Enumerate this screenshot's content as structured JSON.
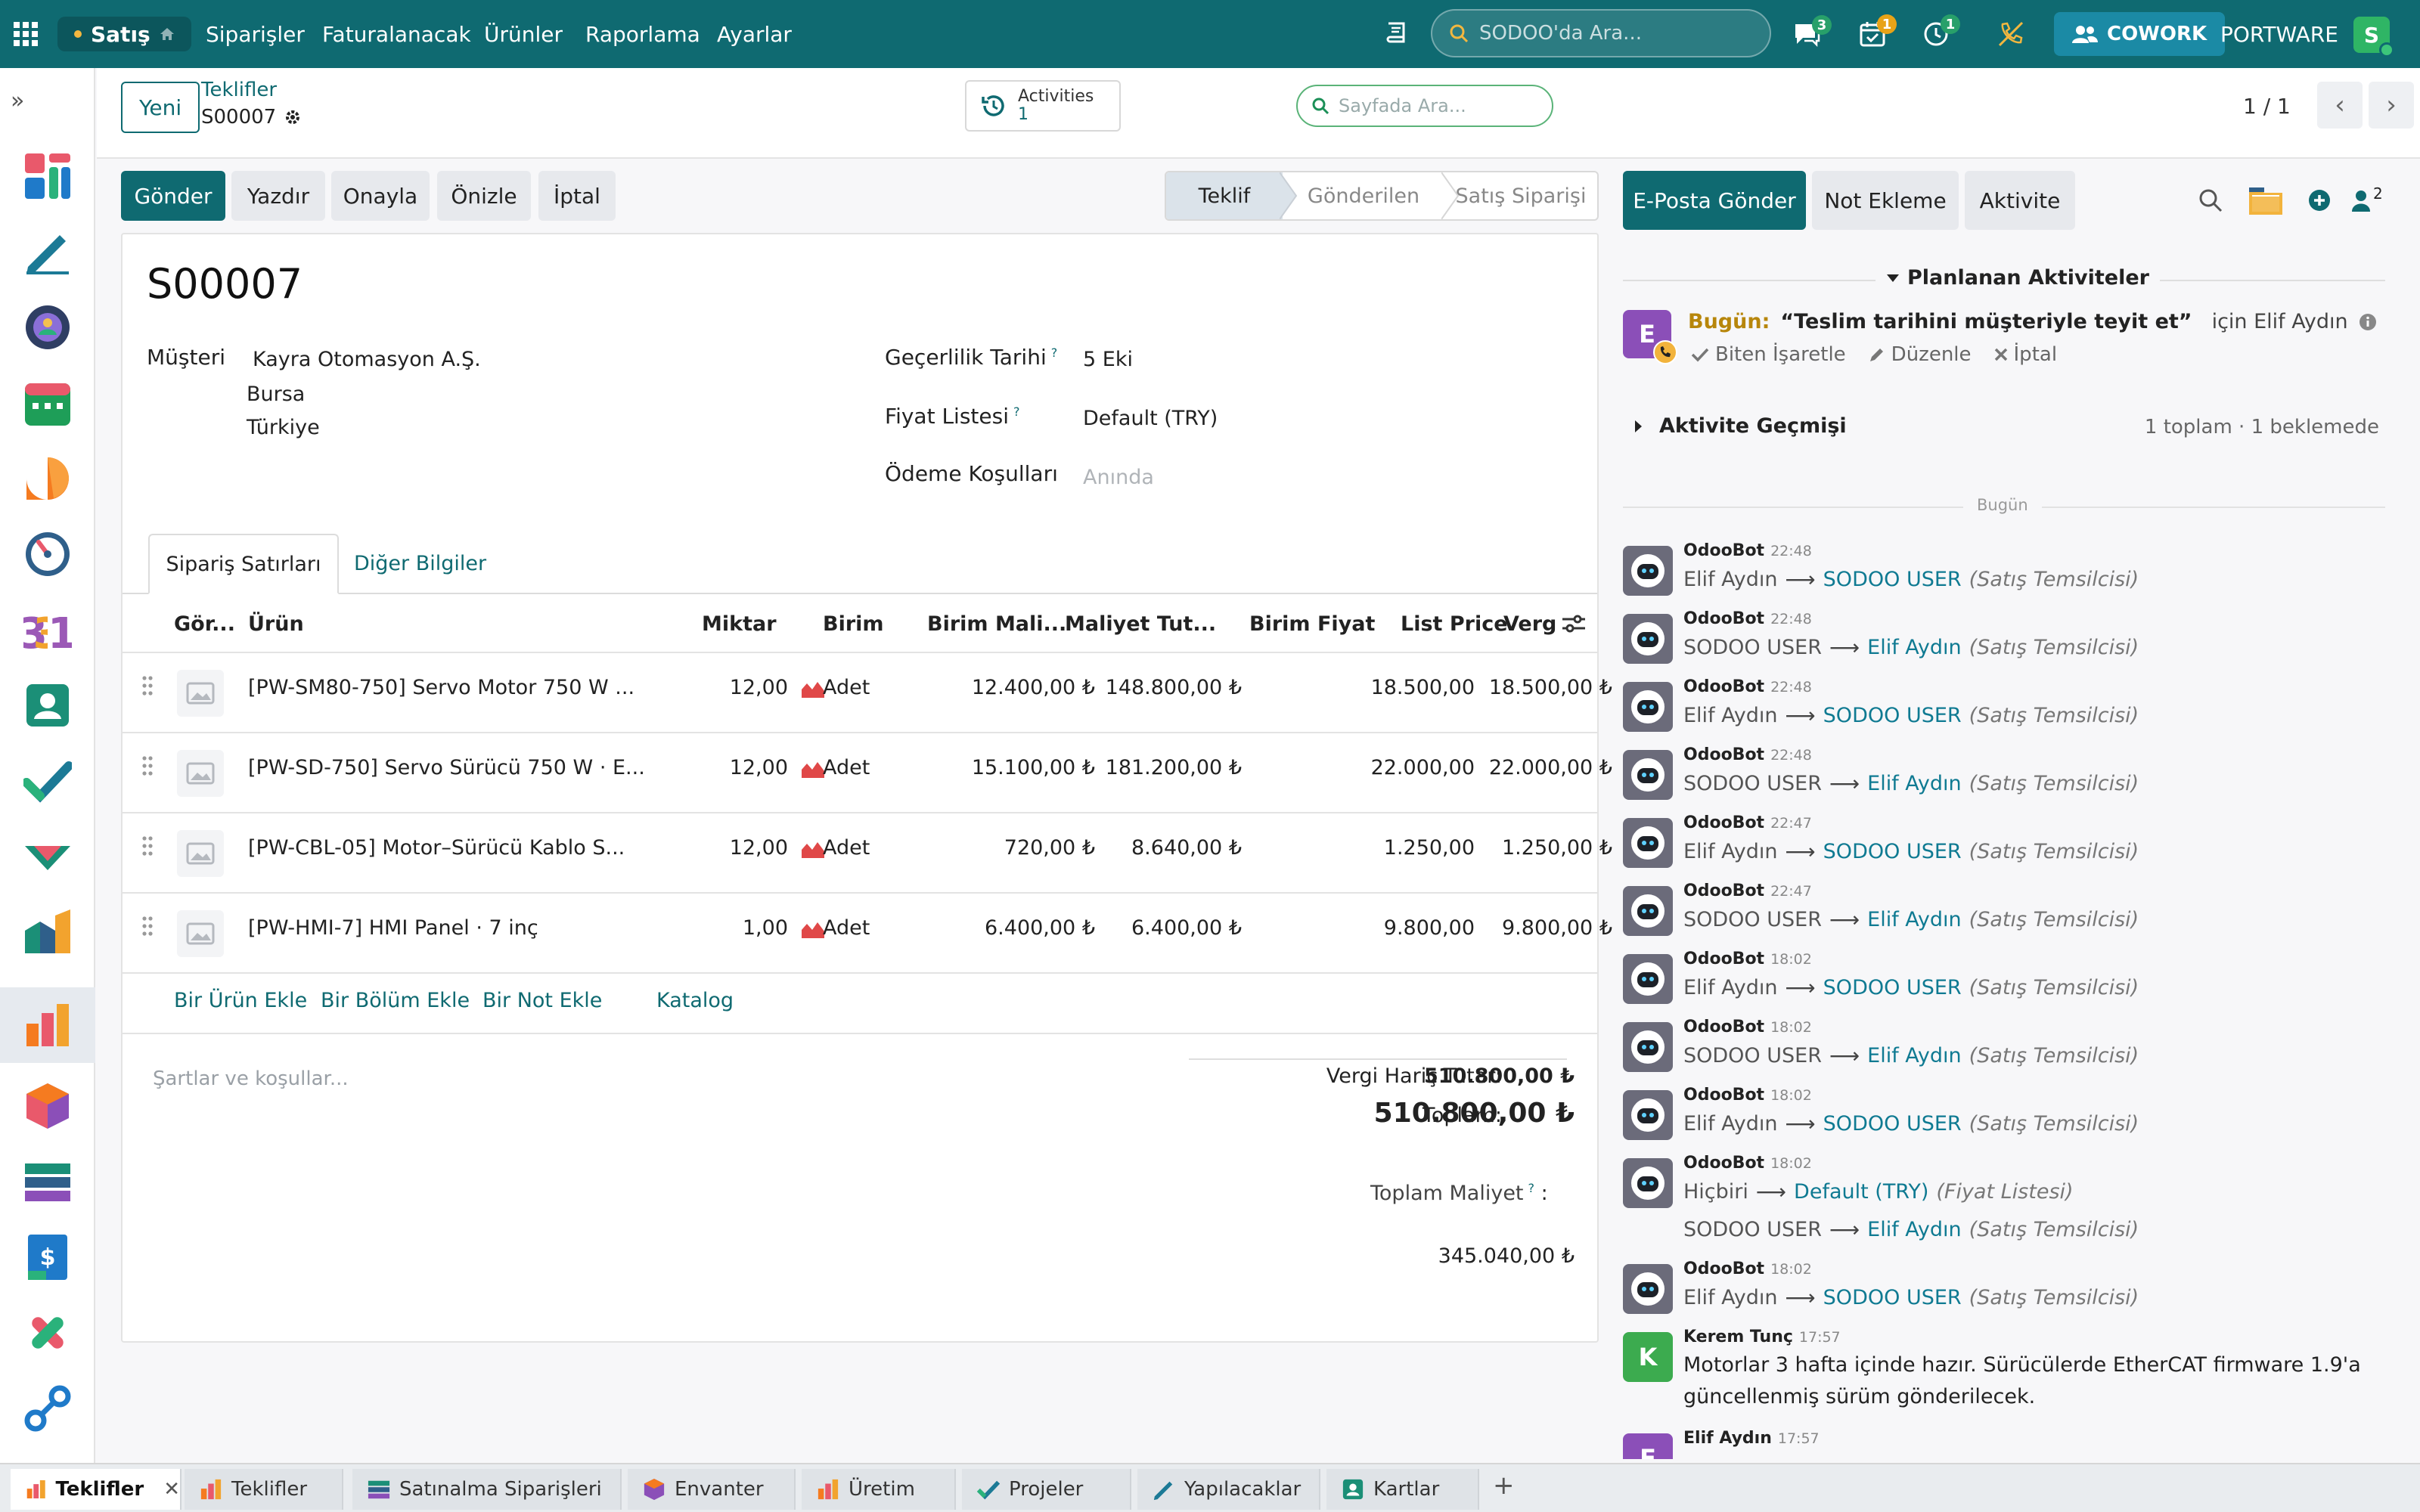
{
  "topbar": {
    "app_name": "Satış",
    "menu": [
      "Siparişler",
      "Faturalanacak",
      "Ürünler",
      "Raporlama",
      "Ayarlar"
    ],
    "search_placeholder": "SODOO'da Ara...",
    "badges": {
      "messages": "3",
      "activities": "1",
      "timer": "1"
    },
    "cowork": "COWORK",
    "company": "PORTWARE",
    "user_initial": "S"
  },
  "control": {
    "new_button": "Yeni",
    "breadcrumb_parent": "Teklifler",
    "breadcrumb_current": "S00007",
    "activities_label": "Activities",
    "activities_count": "1",
    "page_search_placeholder": "Sayfada Ara...",
    "pager": "1 / 1"
  },
  "actions": {
    "send": "Gönder",
    "print": "Yazdır",
    "confirm": "Onayla",
    "preview": "Önizle",
    "cancel": "İptal"
  },
  "status": [
    "Teklif",
    "Gönderilen",
    "Satış Siparişi"
  ],
  "form": {
    "title": "S00007",
    "customer_label": "Müşteri",
    "customer_name": "Kayra Otomasyon A.Ş.",
    "customer_city": "Bursa",
    "customer_country": "Türkiye",
    "validity_label": "Geçerlilik Tarihi",
    "validity_value": "5 Eki",
    "pricelist_label": "Fiyat Listesi",
    "pricelist_value": "Default (TRY)",
    "payment_label": "Ödeme Koşulları",
    "payment_placeholder": "Anında",
    "help_mark": "?",
    "tabs": [
      "Sipariş Satırları",
      "Diğer Bilgiler"
    ],
    "columns": [
      "Gör...",
      "Ürün",
      "Miktar",
      "Birim",
      "Birim Mali...",
      "Maliyet Tut...",
      "Birim Fiyat",
      "List Price",
      "Verg"
    ],
    "lines": [
      {
        "product": "[PW-SM80-750] Servo Motor 750 W ...",
        "qty": "12,00",
        "uom": "Adet",
        "unit_cost": "12.400,00 ₺",
        "cost_total": "148.800,00 ₺",
        "unit_price": "18.500,00",
        "list_price": "18.500,00 ₺"
      },
      {
        "product": "[PW-SD-750] Servo Sürücü 750 W · E...",
        "qty": "12,00",
        "uom": "Adet",
        "unit_cost": "15.100,00 ₺",
        "cost_total": "181.200,00 ₺",
        "unit_price": "22.000,00",
        "list_price": "22.000,00 ₺"
      },
      {
        "product": "[PW-CBL-05] Motor–Sürücü Kablo S...",
        "qty": "12,00",
        "uom": "Adet",
        "unit_cost": "720,00 ₺",
        "cost_total": "8.640,00 ₺",
        "unit_price": "1.250,00",
        "list_price": "1.250,00 ₺"
      },
      {
        "product": "[PW-HMI-7] HMI Panel · 7 inç",
        "qty": "1,00",
        "uom": "Adet",
        "unit_cost": "6.400,00 ₺",
        "cost_total": "6.400,00 ₺",
        "unit_price": "9.800,00",
        "list_price": "9.800,00 ₺"
      }
    ],
    "add_links": [
      "Bir Ürün Ekle",
      "Bir Bölüm Ekle",
      "Bir Not Ekle",
      "Katalog"
    ],
    "terms_placeholder": "Şartlar ve koşullar...",
    "untaxed_label": "Vergi Hariç Tutar:",
    "untaxed_value": "510.800,00 ₺",
    "total_label": "Toplam:",
    "total_value": "510.800,00 ₺",
    "total_cost_label": "Toplam Maliyet",
    "total_cost_colon": ":",
    "total_cost_value": "345.040,00 ₺"
  },
  "chatter": {
    "send_mail": "E-Posta Gönder",
    "log_note": "Not Ekleme",
    "activity": "Aktivite",
    "followers_count": "2",
    "planned_title": "Planlanan Aktiviteler",
    "planned": {
      "avatar": "E",
      "when": "Bugün:",
      "summary": "“Teslim tarihini müşteriyle teyit et”",
      "for_user": "için Elif Aydın",
      "mark_done": "Biten İşaretle",
      "edit": "Düzenle",
      "cancel": "İptal"
    },
    "history_title": "Aktivite Geçmişi",
    "history_summary": "1 toplam · 1 beklemede",
    "day_separator": "Bugün",
    "messages": [
      {
        "author": "OdooBot",
        "time": "22:48",
        "old": "Elif Aydın",
        "new": "SODOO USER",
        "field": "(Satış Temsilcisi)"
      },
      {
        "author": "OdooBot",
        "time": "22:48",
        "old": "SODOO USER",
        "new": "Elif Aydın",
        "field": "(Satış Temsilcisi)"
      },
      {
        "author": "OdooBot",
        "time": "22:48",
        "old": "Elif Aydın",
        "new": "SODOO USER",
        "field": "(Satış Temsilcisi)"
      },
      {
        "author": "OdooBot",
        "time": "22:48",
        "old": "SODOO USER",
        "new": "Elif Aydın",
        "field": "(Satış Temsilcisi)"
      },
      {
        "author": "OdooBot",
        "time": "22:47",
        "old": "Elif Aydın",
        "new": "SODOO USER",
        "field": "(Satış Temsilcisi)"
      },
      {
        "author": "OdooBot",
        "time": "22:47",
        "old": "SODOO USER",
        "new": "Elif Aydın",
        "field": "(Satış Temsilcisi)"
      },
      {
        "author": "OdooBot",
        "time": "18:02",
        "old": "Elif Aydın",
        "new": "SODOO USER",
        "field": "(Satış Temsilcisi)"
      },
      {
        "author": "OdooBot",
        "time": "18:02",
        "old": "SODOO USER",
        "new": "Elif Aydın",
        "field": "(Satış Temsilcisi)"
      },
      {
        "author": "OdooBot",
        "time": "18:02",
        "old": "Elif Aydın",
        "new": "SODOO USER",
        "field": "(Satış Temsilcisi)"
      }
    ],
    "multi_message": {
      "author": "OdooBot",
      "time": "18:02",
      "change1": {
        "old": "Hiçbiri",
        "new": "Default (TRY)",
        "field": "(Fiyat Listesi)"
      },
      "change2": {
        "old": "SODOO USER",
        "new": "Elif Aydın",
        "field": "(Satış Temsilcisi)"
      }
    },
    "last_bot_message": {
      "author": "OdooBot",
      "time": "18:02",
      "old": "Elif Aydın",
      "new": "SODOO USER",
      "field": "(Satış Temsilcisi)"
    },
    "note_message": {
      "avatar": "K",
      "author": "Kerem Tunç",
      "time": "17:57",
      "line1": "Motorlar 3 hafta içinde hazır. Sürücülerde EtherCAT firmware 1.9'a",
      "line2": "güncellenmiş sürüm gönderilecek."
    },
    "partial_message": {
      "avatar": "E",
      "author": "Elif Aydın",
      "time": "17:57"
    }
  },
  "bottom_tabs": [
    "Teklifler",
    "Teklifler",
    "Satınalma Siparişleri",
    "Envanter",
    "Üretim",
    "Projeler",
    "Yapılacaklar",
    "Kartlar"
  ],
  "colors": {
    "primary": "#0f6a71",
    "accent_link": "#0f7a92",
    "activity_today": "#b7860b"
  }
}
